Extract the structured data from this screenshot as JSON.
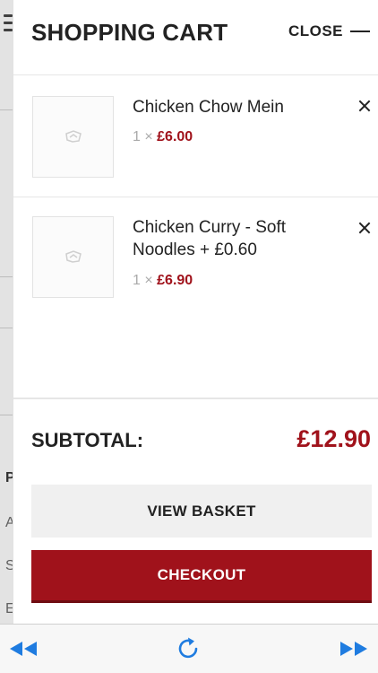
{
  "background_page": {
    "edge_chars": [
      "P",
      "A",
      "S",
      "E"
    ]
  },
  "cart": {
    "title": "SHOPPING CART",
    "close_label": "CLOSE",
    "items": [
      {
        "name": "Chicken Chow Mein",
        "quantity": "1 ×",
        "price": "£6.00"
      },
      {
        "name": "Chicken Curry - Soft Noodles + £0.60",
        "quantity": "1 ×",
        "price": "£6.90"
      }
    ],
    "subtotal_label": "SUBTOTAL:",
    "subtotal_value": "£12.90",
    "view_basket_label": "VIEW BASKET",
    "checkout_label": "CHECKOUT"
  },
  "toolbar": {
    "icons": [
      "rewind-icon",
      "reload-icon",
      "fast-forward-icon"
    ]
  },
  "colors": {
    "accent": "#a0121b",
    "toolbar_icon": "#1f7ce0",
    "text": "#222222"
  }
}
